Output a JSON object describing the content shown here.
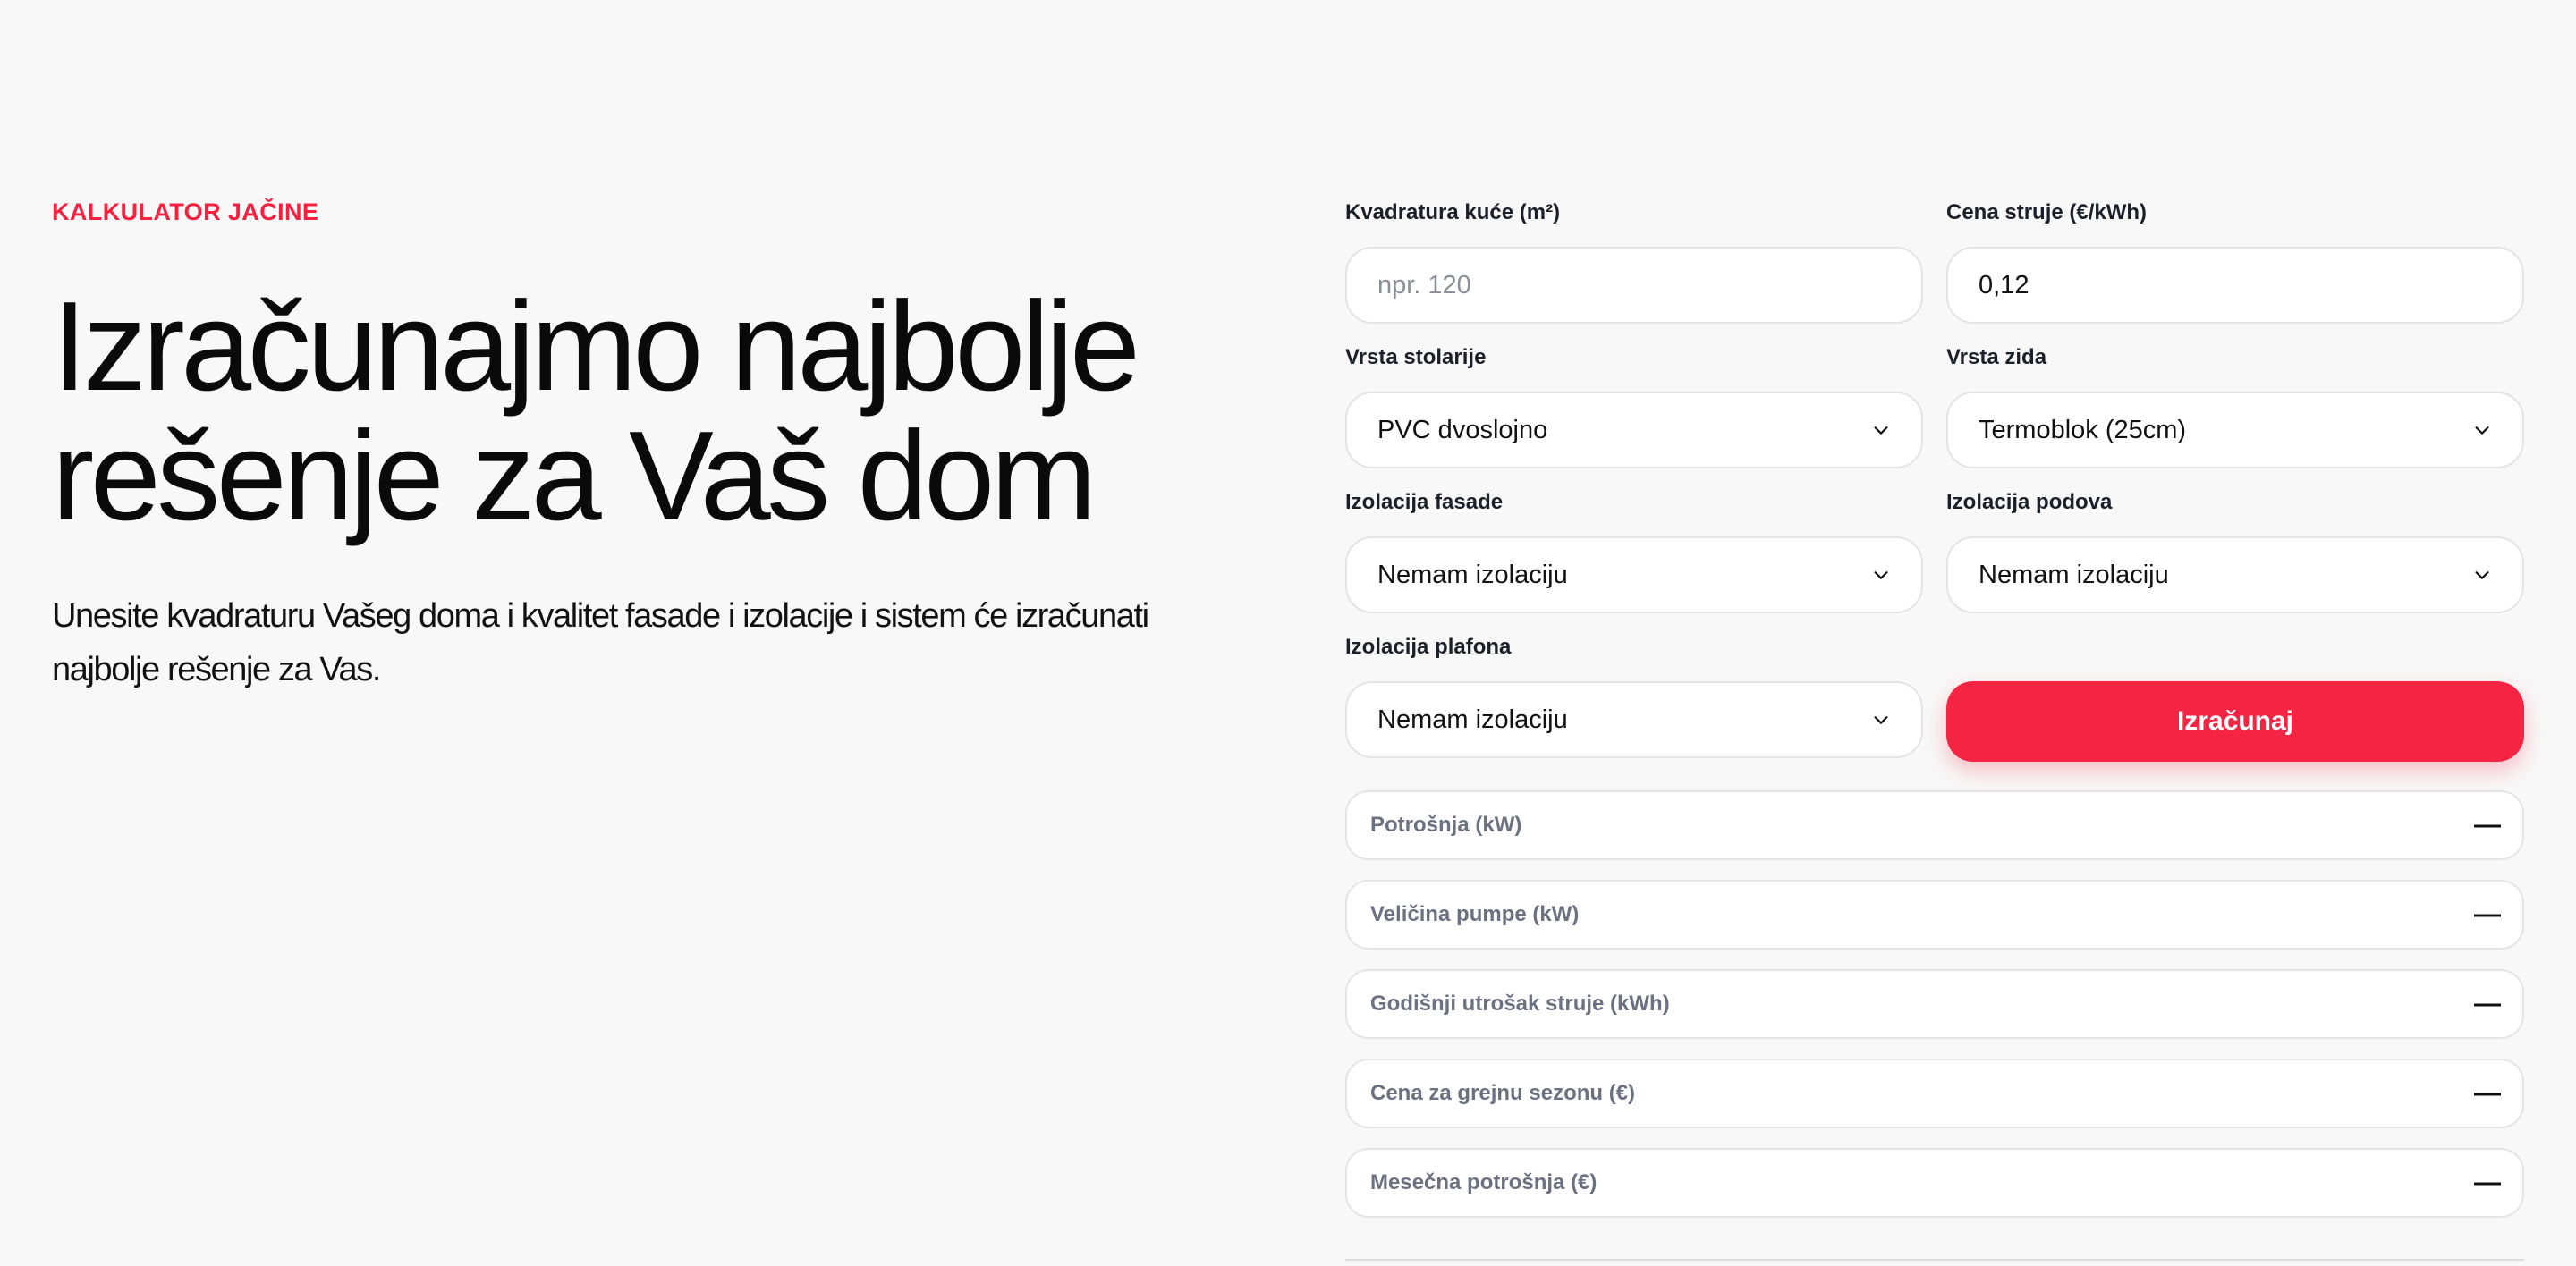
{
  "hero": {
    "eyebrow": "KALKULATOR JAČINE",
    "headline_line1": "Izračunajmo najbolje",
    "headline_line2": "rešenje za Vaš dom",
    "lead": "Unesite kvadraturu Vašeg doma i kvalitet fasade i izolacije i sistem će izračunati najbolje rešenje za Vas."
  },
  "form": {
    "area": {
      "label": "Kvadratura kuće (m²)",
      "value": "",
      "placeholder": "npr. 120"
    },
    "price": {
      "label": "Cena struje (€/kWh)",
      "value": "0,12",
      "placeholder": ""
    },
    "windows": {
      "label": "Vrsta stolarije",
      "selected": "PVC dvoslojno"
    },
    "wall": {
      "label": "Vrsta zida",
      "selected": "Termoblok (25cm)"
    },
    "facade": {
      "label": "Izolacija fasade",
      "selected": "Nemam izolaciju"
    },
    "floor": {
      "label": "Izolacija podova",
      "selected": "Nemam izolaciju"
    },
    "ceiling": {
      "label": "Izolacija plafona",
      "selected": "Nemam izolaciju"
    },
    "submit_label": "Izračunaj"
  },
  "results": [
    {
      "label": "Potrošnja (kW)",
      "value": "—"
    },
    {
      "label": "Veličina pumpe (kW)",
      "value": "—"
    },
    {
      "label": "Godišnji utrošak struje (kWh)",
      "value": "—"
    },
    {
      "label": "Cena za grejnu sezonu (€)",
      "value": "—"
    },
    {
      "label": "Mesečna potrošnja (€)",
      "value": "—"
    }
  ],
  "colors": {
    "accent": "#f62443",
    "eyebrow": "#f5213f",
    "background": "#f8f8f8",
    "border": "#e4e4e7"
  },
  "icons": {
    "select_arrow": "chevron-down-icon"
  }
}
